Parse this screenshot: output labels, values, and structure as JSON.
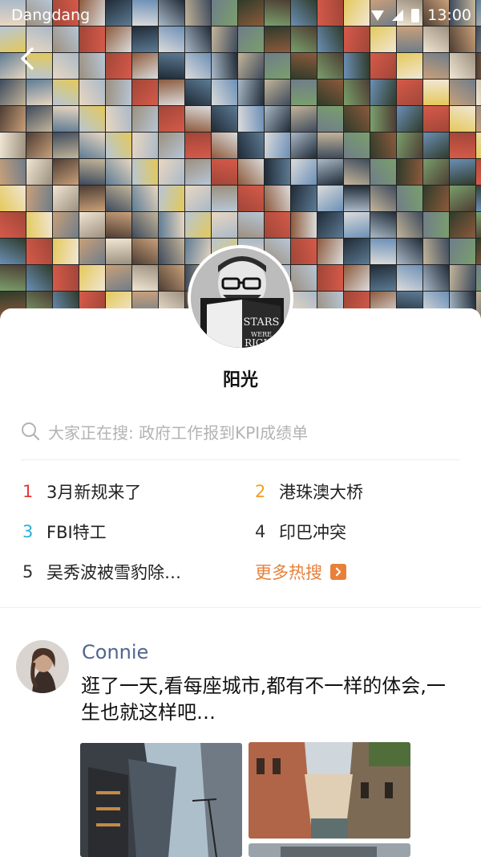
{
  "status_bar": {
    "carrier": "Dangdang",
    "time": "13:00"
  },
  "header": {
    "back_icon": "chevron-left-icon",
    "mosaic_colors": [
      "#6b8fb5",
      "#c9a07a",
      "#3d4a5c",
      "#e9d7c1",
      "#8c5a3c",
      "#aab9c8",
      "#2f3b2a",
      "#d65a4a",
      "#f1e6d4",
      "#5d7b94",
      "#9c8f7e",
      "#1f2a36",
      "#c4b59a",
      "#7a9f6c",
      "#e4c95a",
      "#4d3d33",
      "#b7c6d6",
      "#a04638",
      "#dcdcdc",
      "#6f7d89"
    ]
  },
  "profile": {
    "name": "阳光",
    "avatar_icon": "person-reading-avatar"
  },
  "search": {
    "placeholder": "大家正在搜: 政府工作报到KPI成绩单"
  },
  "hot_searches": [
    {
      "rank": "1",
      "label": "3月新规来了"
    },
    {
      "rank": "2",
      "label": "港珠澳大桥"
    },
    {
      "rank": "3",
      "label": "FBI特工"
    },
    {
      "rank": "4",
      "label": "印巴冲突"
    },
    {
      "rank": "5",
      "label": "吴秀波被雪豹除…"
    }
  ],
  "more_hot": {
    "label": "更多热搜",
    "icon": "chevron-right-icon"
  },
  "post": {
    "author": "Connie",
    "text": "逛了一天,看每座城市,都有不一样的体会,一生也就这样吧…"
  },
  "colors": {
    "accent_orange": "#e8803a",
    "author_blue": "#51668e",
    "rank1": "#e53935",
    "rank2": "#f0a020",
    "rank3": "#2ab0d6"
  }
}
